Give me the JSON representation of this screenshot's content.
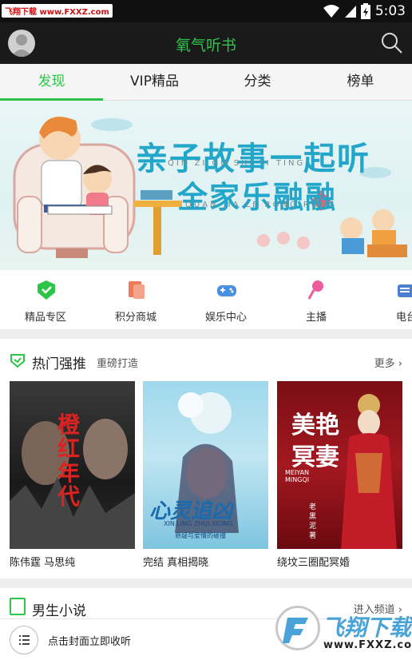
{
  "status_bar": {
    "watermark": "飞翔下载 www.FXXZ.com",
    "time": "5:03",
    "icons": [
      "wifi-icon",
      "signal-icon",
      "battery-icon"
    ]
  },
  "app_bar": {
    "title": "氧气听书",
    "avatar_icon": "user-avatar-icon",
    "search_icon": "search-icon"
  },
  "tabs": [
    {
      "label": "发现",
      "active": true
    },
    {
      "label": "VIP精品",
      "active": false
    },
    {
      "label": "分类",
      "active": false
    },
    {
      "label": "榜单",
      "active": false
    }
  ],
  "banner": {
    "title_line1": "亲子故事一起听",
    "pinyin_line1": "QIN ZI GU SHI YI TING",
    "title_line2": "全家乐融融",
    "pinyin_line2": "QUAN JIA LE RONG RONG"
  },
  "quick_nav": [
    {
      "label": "精品专区",
      "icon": "premium-badge-icon",
      "color": "#2ec44a"
    },
    {
      "label": "积分商城",
      "icon": "points-mall-icon",
      "color": "#ee7a5a"
    },
    {
      "label": "娱乐中心",
      "icon": "gamepad-icon",
      "color": "#4a8fe0"
    },
    {
      "label": "主播",
      "icon": "microphone-icon",
      "color": "#ee5a9a"
    },
    {
      "label": "电台",
      "icon": "radio-icon",
      "color": "#4a7fd0"
    }
  ],
  "hot_section": {
    "title": "热门强推",
    "subtitle": "重磅打造",
    "more": "更多",
    "books": [
      {
        "caption": "陈伟霆 马思纯",
        "cover_text": "橙红年代"
      },
      {
        "caption": "完结 真相揭晓",
        "cover_text": "心灵追凶",
        "cover_pinyin": "XIN LING ZHUI XIONG",
        "cover_sub": "悬疑与爱情的碰撞"
      },
      {
        "caption": "绕坟三圈配冥婚",
        "cover_text": "美艳冥妻",
        "cover_pinyin": "MEIYAN MINGQI",
        "cover_author": "老黑泥 著"
      }
    ]
  },
  "boy_section": {
    "title": "男生小说",
    "more": "进入频道"
  },
  "bottom_bar": {
    "hint": "点击封面立即收听"
  },
  "watermark_logo": {
    "text": "飞翔下载",
    "url": "www.FXXZ.com"
  },
  "colors": {
    "accent": "#2ec44a",
    "app_bar": "#1a1a1a",
    "banner_text": "#22a6c9"
  }
}
